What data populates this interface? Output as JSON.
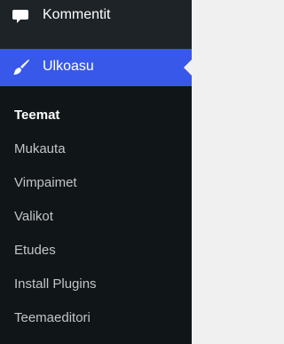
{
  "menu": {
    "comments": {
      "label": "Kommentit",
      "icon": "comment-icon"
    },
    "appearance": {
      "label": "Ulkoasu",
      "icon": "paintbrush-icon",
      "accent": "#3858e9"
    }
  },
  "submenu": [
    {
      "label": "Teemat",
      "current": true
    },
    {
      "label": "Mukauta"
    },
    {
      "label": "Vimpaimet"
    },
    {
      "label": "Valikot"
    },
    {
      "label": "Etudes"
    },
    {
      "label": "Install Plugins"
    },
    {
      "label": "Teemaeditori"
    }
  ]
}
